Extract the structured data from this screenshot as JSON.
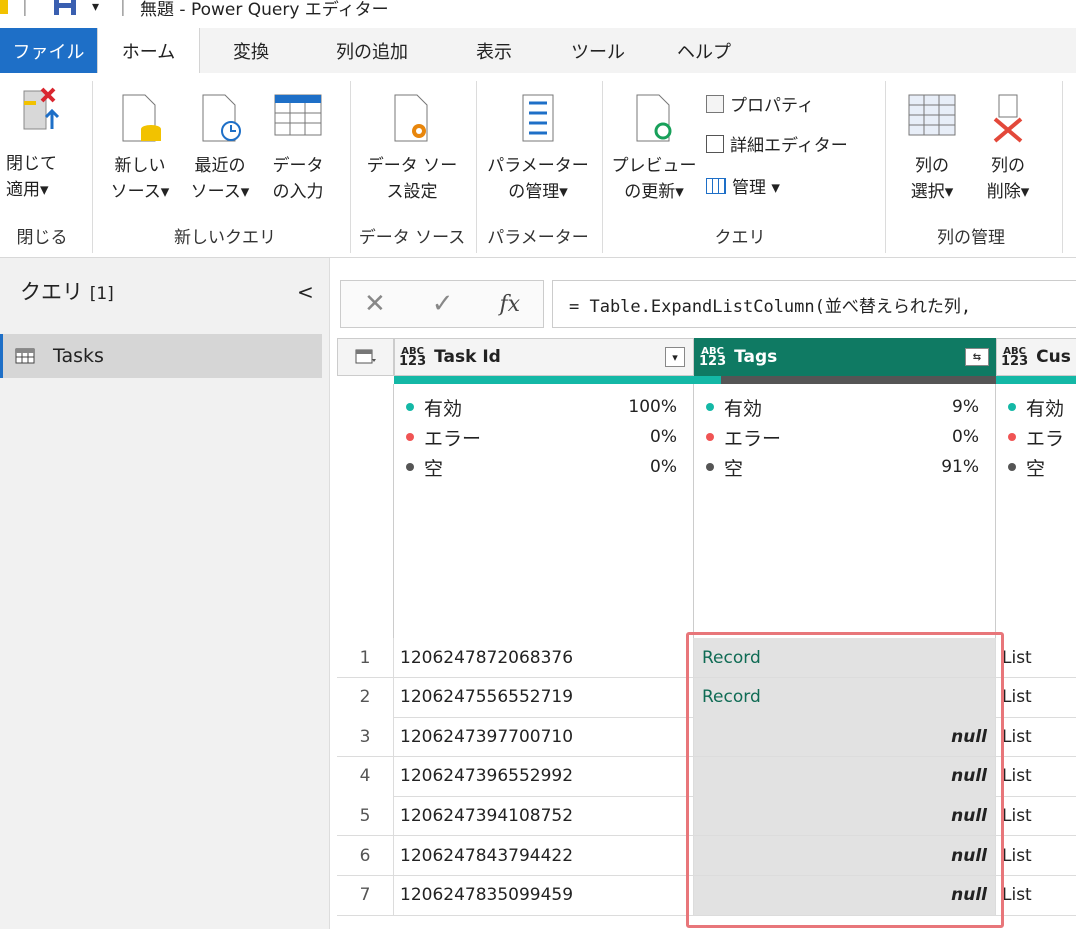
{
  "titlebar": {
    "title": "無題 - Power Query エディター"
  },
  "ribbon_tabs": [
    "ファイル",
    "ホーム",
    "変換",
    "列の追加",
    "表示",
    "ツール",
    "ヘルプ"
  ],
  "ribbon": {
    "close_apply": "閉じて\n適用▾",
    "new_source": "新しい\nソース▾",
    "recent_sources": "最近の\nソース▾",
    "enter_data": "データ\nの入力",
    "data_source_settings": "データ ソー\nス設定",
    "manage_params": "パラメーター\nの管理▾",
    "refresh_preview": "プレビュー\nの更新▾",
    "properties": "プロパティ",
    "advanced_editor": "詳細エディター",
    "manage": "管理 ▾",
    "choose_columns": "列の\n選択▾",
    "remove_columns": "列の\n削除▾",
    "groups": {
      "close": "閉じる",
      "new_query": "新しいクエリ",
      "data_sources": "データ ソース",
      "parameters": "パラメーター",
      "query": "クエリ",
      "manage_columns": "列の管理"
    }
  },
  "queries_pane": {
    "title": "クエリ",
    "count": "[1]",
    "collapse": "<",
    "items": [
      "Tasks"
    ]
  },
  "formula_bar": {
    "cancel": "✕",
    "commit": "✓",
    "fx": "fx",
    "formula": "= Table.ExpandListColumn(並べ替えられた列,"
  },
  "columns": [
    {
      "type_top": "ABC",
      "type_bottom": "123",
      "name": "Task Id",
      "profile": {
        "valid_label": "有効",
        "valid": "100%",
        "error_label": "エラー",
        "error": "0%",
        "empty_label": "空",
        "empty": "0%"
      }
    },
    {
      "type_top": "ABC",
      "type_bottom": "123",
      "name": "Tags",
      "profile": {
        "valid_label": "有効",
        "valid": "9%",
        "error_label": "エラー",
        "error": "0%",
        "empty_label": "空",
        "empty": "91%"
      }
    },
    {
      "type_top": "ABC",
      "type_bottom": "123",
      "name": "Cus",
      "profile": {
        "valid_label": "有効",
        "error_label": "エラ",
        "empty_label": "空"
      }
    }
  ],
  "rows": [
    {
      "idx": "1",
      "task_id": "1206247872068376",
      "tags": "Record",
      "cust": "List"
    },
    {
      "idx": "2",
      "task_id": "1206247556552719",
      "tags": "Record",
      "cust": "List"
    },
    {
      "idx": "3",
      "task_id": "1206247397700710",
      "tags": "null",
      "cust": "List"
    },
    {
      "idx": "4",
      "task_id": "1206247396552992",
      "tags": "null",
      "cust": "List"
    },
    {
      "idx": "5",
      "task_id": "1206247394108752",
      "tags": "null",
      "cust": "List"
    },
    {
      "idx": "6",
      "task_id": "1206247843794422",
      "tags": "null",
      "cust": "List"
    },
    {
      "idx": "7",
      "task_id": "1206247835099459",
      "tags": "null",
      "cust": "List"
    }
  ],
  "colors": {
    "accent": "#1e6fc7",
    "selected_header": "#0f7a63",
    "valid": "#14b8a6",
    "error": "#f05454",
    "empty": "#555555",
    "highlight": "#e8767a"
  }
}
